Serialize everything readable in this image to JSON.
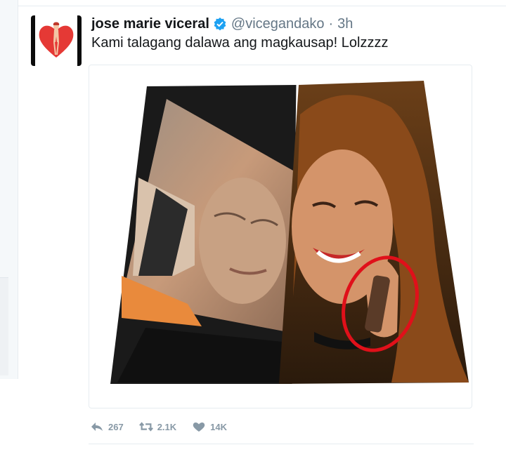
{
  "tweet": {
    "display_name": "jose marie viceral",
    "verified": true,
    "handle": "@vicegandako",
    "separator": "·",
    "time": "3h",
    "text": "Kami talagang dalawa ang magkausap! Lolzzzz"
  },
  "media": {
    "description_icon": "photo-collage",
    "highlight_color": "#e0101a"
  },
  "actions": {
    "reply": {
      "icon": "reply-icon",
      "count": "267"
    },
    "retweet": {
      "icon": "retweet-icon",
      "count": "2.1K"
    },
    "like": {
      "icon": "heart-icon",
      "count": "14K"
    }
  },
  "colors": {
    "verified_blue": "#1da1f2",
    "muted_text": "#657786",
    "action_gray": "#8899a6"
  }
}
